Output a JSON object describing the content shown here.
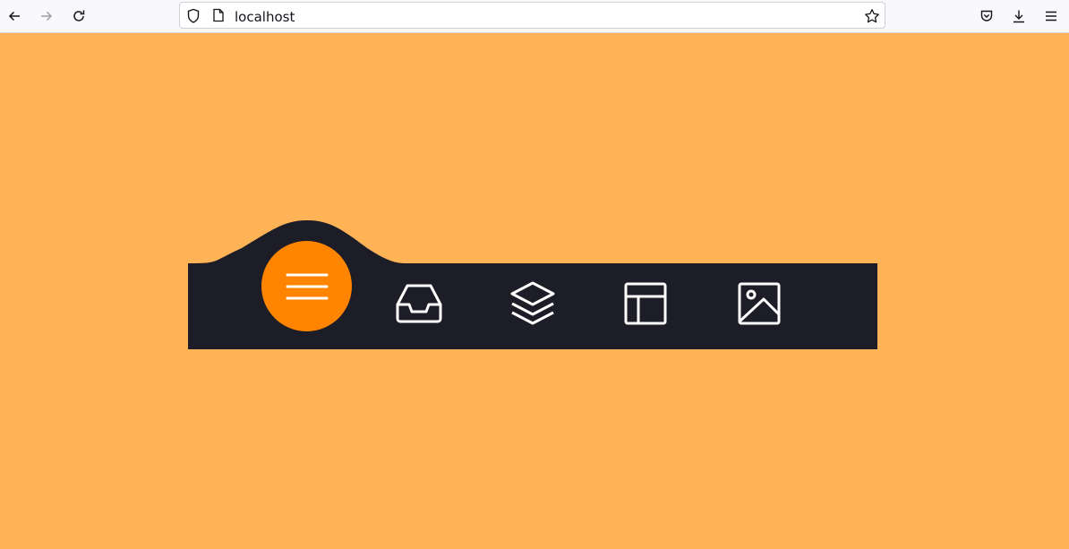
{
  "browser": {
    "url": "localhost",
    "icons": {
      "back": "arrow-left-icon",
      "forward": "arrow-right-icon",
      "reload": "reload-icon",
      "shield": "shield-icon",
      "page": "page-icon",
      "bookmark": "star-icon",
      "pocket": "pocket-icon",
      "downloads": "download-icon",
      "menu": "hamburger-icon"
    }
  },
  "nav": {
    "items": [
      {
        "icon": "menu-icon",
        "active": true
      },
      {
        "icon": "inbox-icon",
        "active": false
      },
      {
        "icon": "layers-icon",
        "active": false
      },
      {
        "icon": "layout-icon",
        "active": false
      },
      {
        "icon": "image-icon",
        "active": false
      }
    ]
  },
  "colors": {
    "background": "#ffb357",
    "bar": "#1c1d27",
    "accent": "#ff8500",
    "icon": "#ffffff"
  }
}
